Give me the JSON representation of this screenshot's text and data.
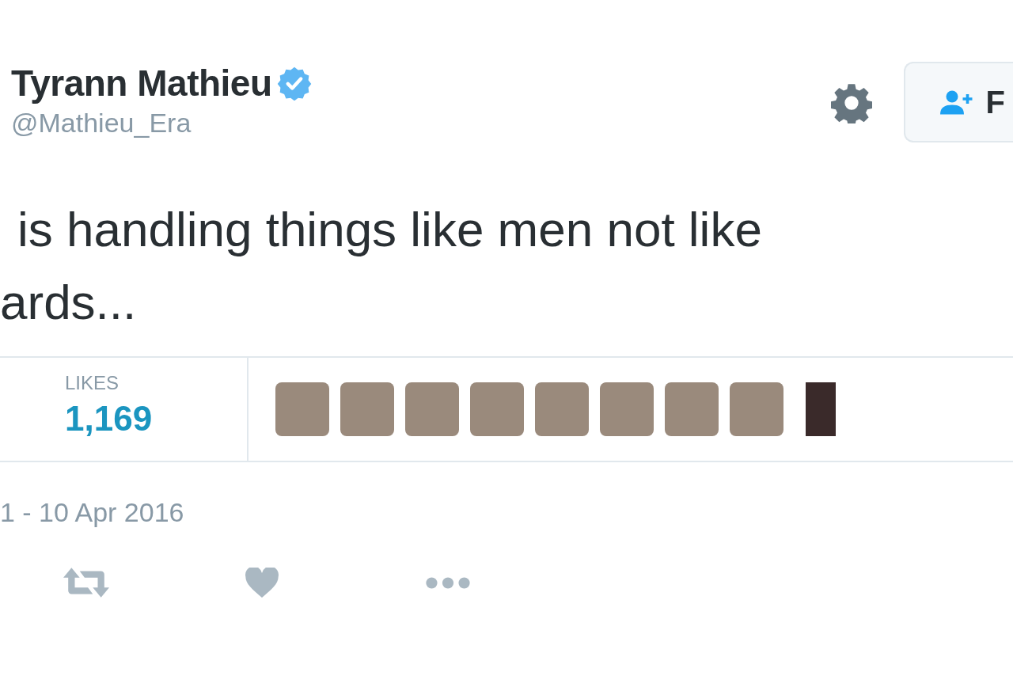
{
  "author": {
    "name": "Tyrann Mathieu",
    "verified": true,
    "handle": "@Mathieu_Era"
  },
  "follow_button": {
    "label": "F"
  },
  "tweet_lines": [
    "is handling things like men not like",
    "ards..."
  ],
  "stats": [
    {
      "label": "LIKES",
      "value": "1,169"
    }
  ],
  "timestamp": "1 - 10 Apr 2016"
}
